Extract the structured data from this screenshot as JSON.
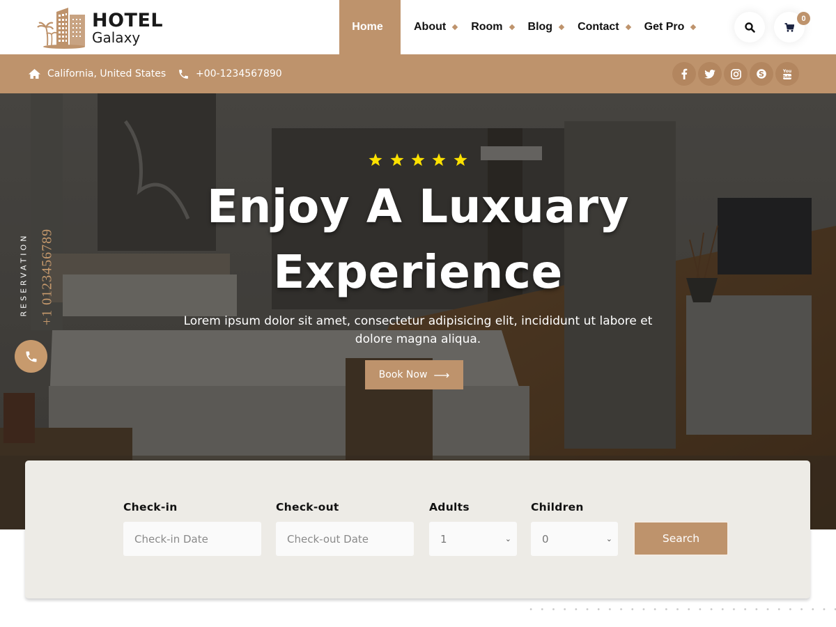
{
  "brand": {
    "name_line1": "HOTEL",
    "name_line2": "Galaxy",
    "accent_color": "#be936c"
  },
  "nav": {
    "items": [
      {
        "label": "Home",
        "active": true
      },
      {
        "label": "About",
        "active": false
      },
      {
        "label": "Room",
        "active": false
      },
      {
        "label": "Blog",
        "active": false
      },
      {
        "label": "Contact",
        "active": false
      },
      {
        "label": "Get Pro",
        "active": false
      }
    ],
    "search_icon": "search-icon",
    "cart_icon": "cart-icon",
    "cart_count": "0"
  },
  "infobar": {
    "location": "California, United States",
    "phone": "+00-1234567890",
    "socials": [
      "facebook",
      "twitter",
      "instagram",
      "skype",
      "youtube"
    ]
  },
  "hero": {
    "rating_stars": 5,
    "title_line1": "Enjoy A Luxuary",
    "title_line2": "Experience",
    "subtitle": "Lorem ipsum dolor sit amet, consectetur adipisicing elit, incididunt ut labore et dolore magna aliqua.",
    "cta_label": "Book Now",
    "cta_arrow": "⟶",
    "reservation_label": "RESERVATION",
    "reservation_phone": "+1 0123456789"
  },
  "booking": {
    "checkin": {
      "label": "Check-in",
      "placeholder": "Check-in Date",
      "value": ""
    },
    "checkout": {
      "label": "Check-out",
      "placeholder": "Check-out Date",
      "value": ""
    },
    "adults": {
      "label": "Adults",
      "value": "1"
    },
    "children": {
      "label": "Children",
      "value": "0"
    },
    "submit_label": "Search"
  }
}
